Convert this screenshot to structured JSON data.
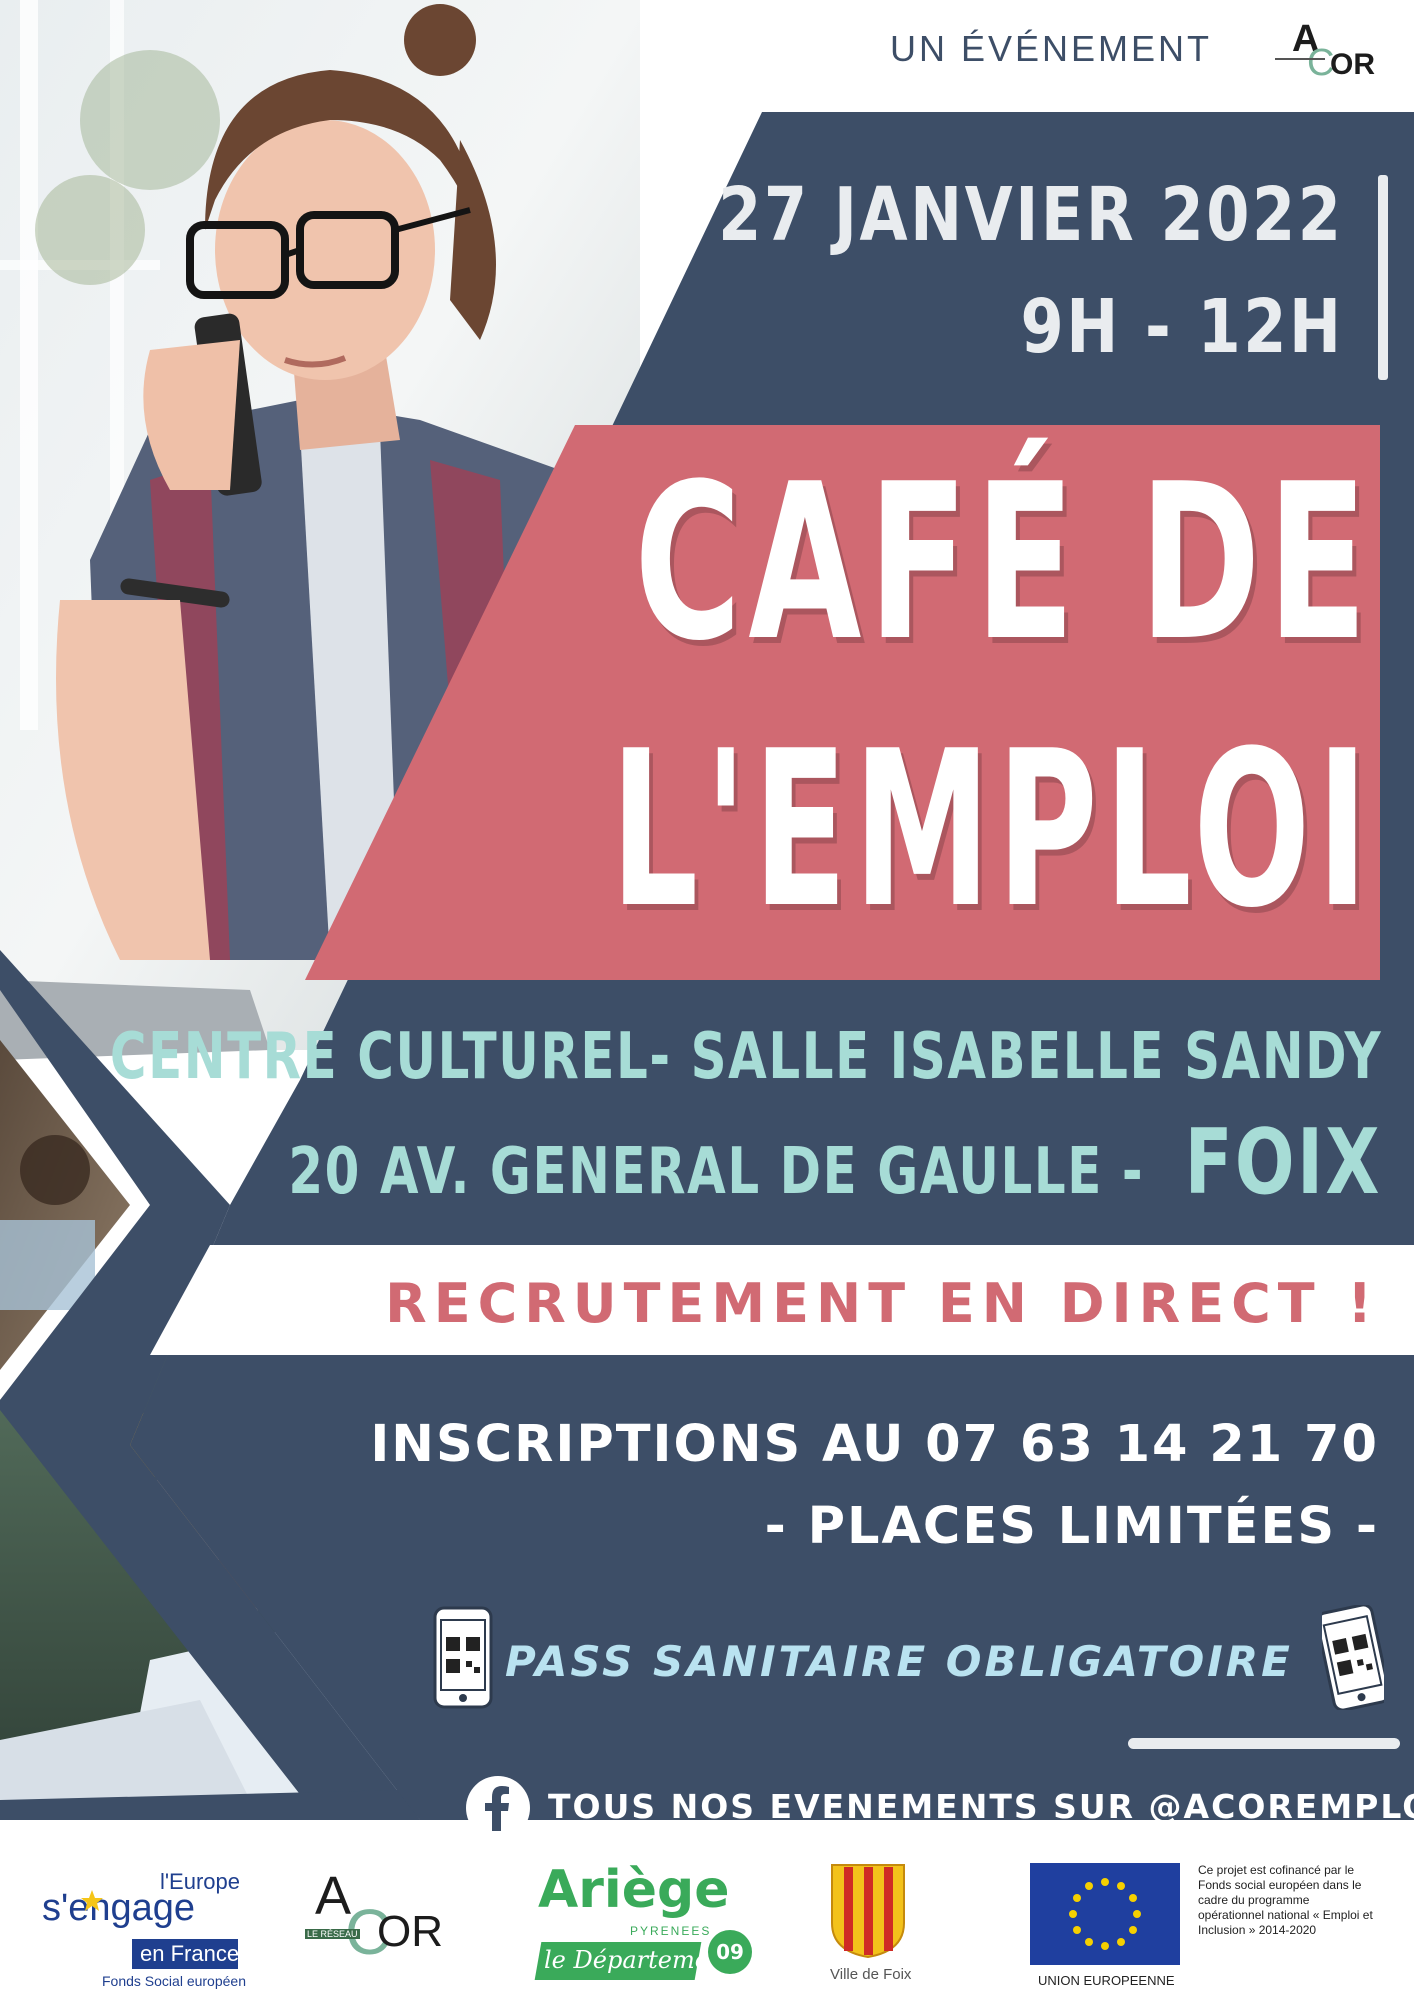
{
  "header": {
    "organizer_prefix": "UN ÉVÉNEMENT",
    "organizer_logo_text": {
      "a": "A",
      "c": "C",
      "or": "OR"
    }
  },
  "event": {
    "date": "27 JANVIER 2022",
    "time": "9H - 12H",
    "title_line1": "CAFÉ DE",
    "title_line2": "L'EMPLOI",
    "venue": "CENTRE CULTUREL- SALLE ISABELLE SANDY",
    "address": "20 AV. GENERAL DE GAULLE -",
    "city": "FOIX"
  },
  "banner": {
    "text": "RECRUTEMENT EN DIRECT !"
  },
  "registration": {
    "line1": "INSCRIPTIONS AU 07 63 14 21 70",
    "line2": "- PLACES LIMITÉES -"
  },
  "health": {
    "text": "PASS SANITAIRE OBLIGATOIRE"
  },
  "social": {
    "text": "TOUS NOS EVENEMENTS SUR @ACOREMPLOI",
    "icon": "facebook-icon"
  },
  "footer": {
    "europe_engage": {
      "top": "l'Europe",
      "brand_s": "s'",
      "brand_rest": "engage",
      "bottom": "en France",
      "fund": "Fonds Social européen"
    },
    "acor": {
      "a": "A",
      "c": "C",
      "or": "OR",
      "small": "LE RÉSEAU"
    },
    "ariege": {
      "name": "Ariège",
      "region": "PYRENEES",
      "dept": "le Département",
      "number": "09"
    },
    "foix": {
      "label": "Ville de Foix"
    },
    "eu": {
      "label": "UNION EUROPEENNE",
      "note": "Ce projet est cofinancé par le Fonds social européen dans le cadre du programme opérationnel national « Emploi et Inclusion » 2014-2020"
    }
  },
  "colors": {
    "navy": "#3d4e67",
    "coral": "#d16a73",
    "mint": "#a7dcd6",
    "light_blue": "#b9e2f0",
    "white": "#ffffff",
    "grey_text": "#3d4e67"
  }
}
